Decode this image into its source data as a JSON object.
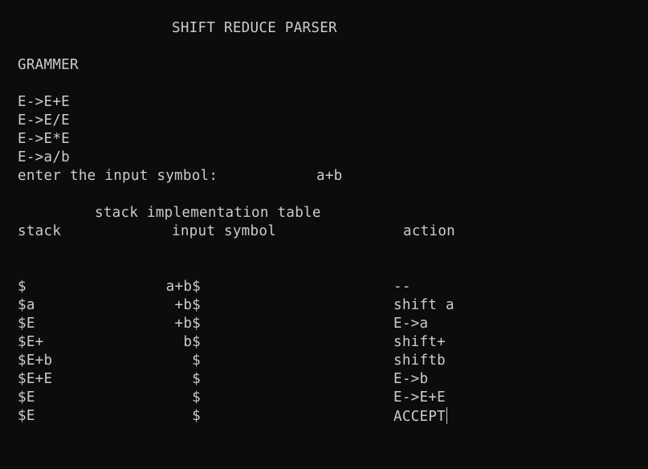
{
  "title": "SHIFT REDUCE PARSER",
  "grammar_heading": "GRAMMER",
  "productions": [
    "E->E+E",
    "E->E/E",
    "E->E*E",
    "E->a/b"
  ],
  "input_prompt": "enter the input symbol:",
  "input_value": "a+b",
  "table_title": "stack implementation table",
  "headers": {
    "stack": "stack",
    "input": "input symbol",
    "action": "action"
  },
  "rows": [
    {
      "stack": "$",
      "input": "a+b$",
      "action": "--"
    },
    {
      "stack": "$a",
      "input": "+b$",
      "action": "shift a"
    },
    {
      "stack": "$E",
      "input": "+b$",
      "action": "E->a"
    },
    {
      "stack": "$E+",
      "input": "b$",
      "action": "shift+"
    },
    {
      "stack": "$E+b",
      "input": "$",
      "action": "shiftb"
    },
    {
      "stack": "$E+E",
      "input": "$",
      "action": "E->b"
    },
    {
      "stack": "$E",
      "input": "$",
      "action": "E->E+E"
    },
    {
      "stack": "$E",
      "input": "$",
      "action": "ACCEPT"
    }
  ]
}
